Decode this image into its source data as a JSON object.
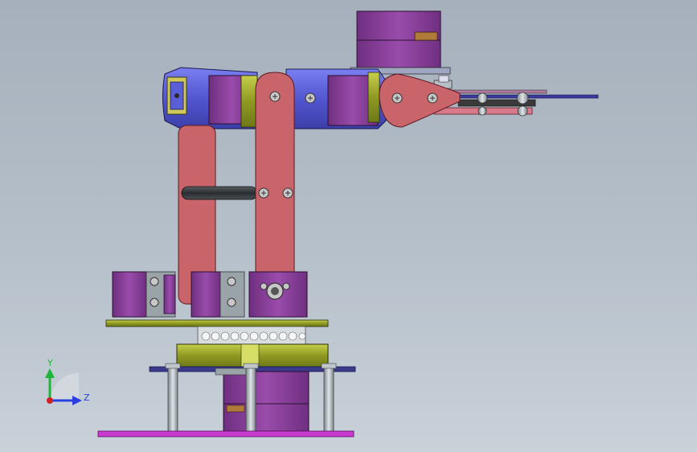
{
  "triad": {
    "y_label": "Y",
    "z_label": "Z"
  },
  "colors": {
    "purple": "#8a3f9a",
    "blue": "#5a5fd8",
    "salmon": "#c9656a",
    "olive": "#9aa628",
    "magenta": "#c83ad0",
    "navy": "#3a3a8c",
    "steel": "#9aa3a8",
    "axis_y": "#1fb43a",
    "axis_z": "#2a3fe0",
    "axis_origin": "#d02020"
  }
}
